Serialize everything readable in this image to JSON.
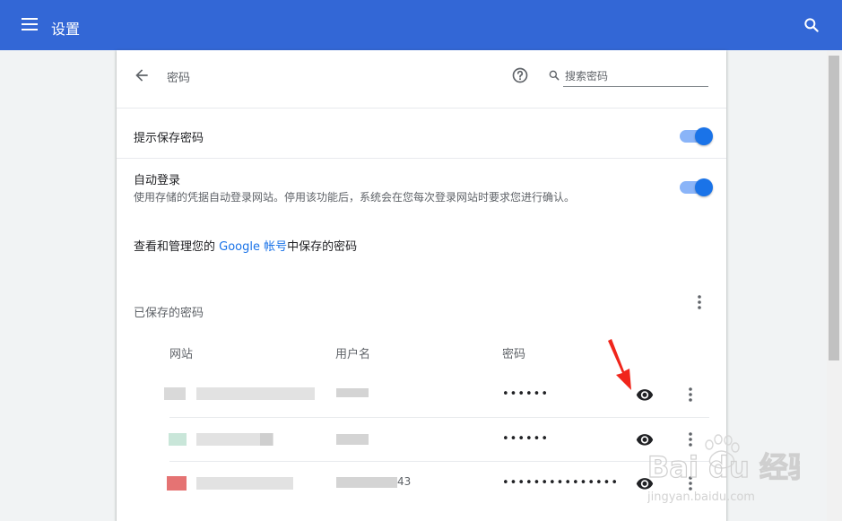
{
  "app": {
    "title": "设置"
  },
  "header": {
    "title": "密码",
    "search_placeholder": "搜索密码"
  },
  "settings": {
    "offer_to_save": {
      "label": "提示保存密码",
      "enabled": true
    },
    "auto_signin": {
      "label": "自动登录",
      "description": "使用存储的凭据自动登录网站。停用该功能后，系统会在您每次登录网站时要求您进行确认。",
      "enabled": true
    },
    "manage": {
      "prefix": "查看和管理您的 ",
      "link": "Google 帐号",
      "suffix": "中保存的密码"
    }
  },
  "saved": {
    "title": "已保存的密码",
    "columns": {
      "site": "网站",
      "username": "用户名",
      "password": "密码"
    },
    "rows": [
      {
        "masked": "••••••",
        "username_suffix": ""
      },
      {
        "masked": "••••••",
        "username_suffix": ""
      },
      {
        "masked": "•••••••••••••••",
        "username_suffix": "43"
      }
    ]
  },
  "watermark": {
    "brand": "Bai du 经验",
    "url": "jingyan.baidu.com"
  },
  "colors": {
    "topbar": "#3367d6",
    "accent": "#1a73e8",
    "toggle_track": "#8ab4f8",
    "arrow": "#f0251b"
  },
  "icons": [
    "menu-icon",
    "search-icon",
    "back-arrow-icon",
    "help-icon",
    "more-vert-icon",
    "eye-icon"
  ]
}
